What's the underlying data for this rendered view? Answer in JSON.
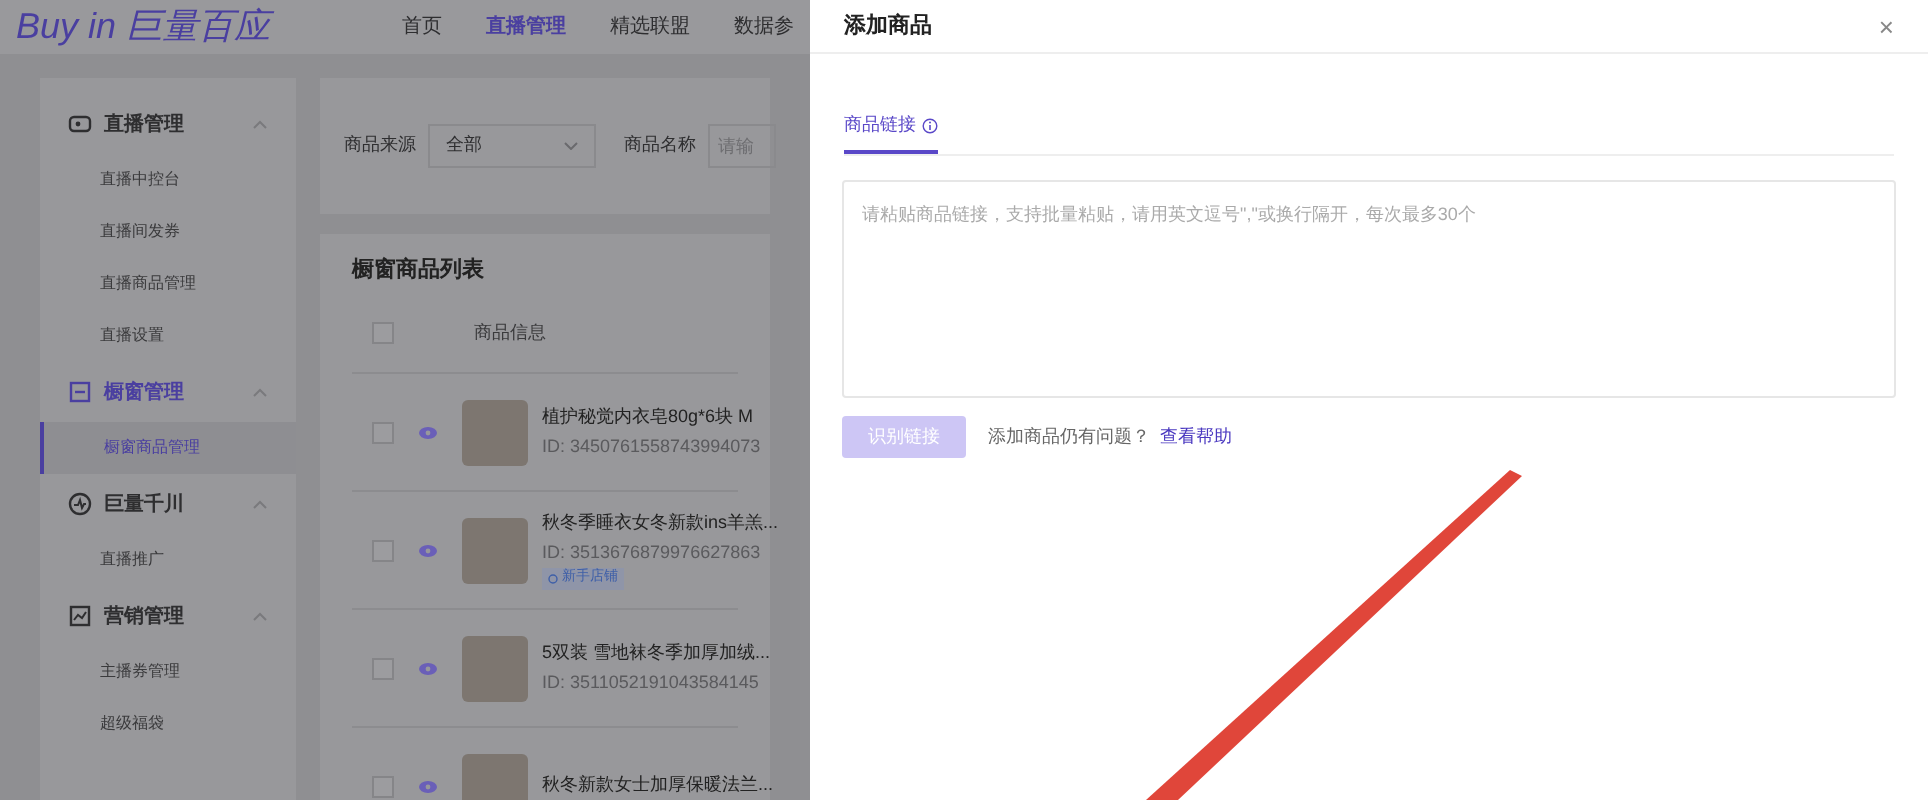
{
  "logo": "Buy in 巨量百应",
  "nav": [
    {
      "label": "首页",
      "selected": false
    },
    {
      "label": "直播管理",
      "selected": true
    },
    {
      "label": "精选联盟",
      "selected": false
    },
    {
      "label": "数据参",
      "selected": false
    }
  ],
  "sidebar": {
    "groups": [
      {
        "label": "直播管理",
        "items": [
          {
            "label": "直播中控台",
            "selected": false
          },
          {
            "label": "直播间发券",
            "selected": false
          },
          {
            "label": "直播商品管理",
            "selected": false
          },
          {
            "label": "直播设置",
            "selected": false
          }
        ]
      },
      {
        "label": "橱窗管理",
        "active": true,
        "items": [
          {
            "label": "橱窗商品管理",
            "selected": true
          }
        ]
      },
      {
        "label": "巨量千川",
        "items": [
          {
            "label": "直播推广",
            "selected": false
          }
        ]
      },
      {
        "label": "营销管理",
        "items": [
          {
            "label": "主播券管理",
            "selected": false
          },
          {
            "label": "超级福袋",
            "selected": false
          }
        ]
      }
    ]
  },
  "filters": [
    {
      "label": "商品来源",
      "kind": "select",
      "value": "全部"
    },
    {
      "label": "商品名称",
      "kind": "input",
      "placeholder": "请输"
    }
  ],
  "list": {
    "title": "橱窗商品列表",
    "column": "商品信息",
    "all_checked": false,
    "rows": [
      {
        "title": "植护秘觉内衣皂80g*6块 M",
        "id": "ID: 3450761558743994073",
        "checked": false
      },
      {
        "title": "秋冬季睡衣女冬新款ins羊羔...",
        "id": "ID: 3513676879976627863",
        "tag": "新手店铺",
        "checked": false
      },
      {
        "title": "5双装 雪地袜冬季加厚加绒...",
        "id": "ID: 3511052191043584145",
        "checked": false
      },
      {
        "title": "秋冬新款女士加厚保暖法兰...",
        "checked": false
      }
    ]
  },
  "dialog": {
    "title": "添加商品",
    "close": "×",
    "tabs": [
      {
        "label": "商品链接",
        "selected": true
      }
    ],
    "textarea": {
      "placeholder": "请粘贴商品链接，支持批量粘贴，请用英文逗号\",\"或换行隔开，每次最多30个"
    },
    "button": {
      "label": "识别链接",
      "disabled": true
    },
    "help_text": "添加商品仍有问题？",
    "help_link": "查看帮助"
  }
}
